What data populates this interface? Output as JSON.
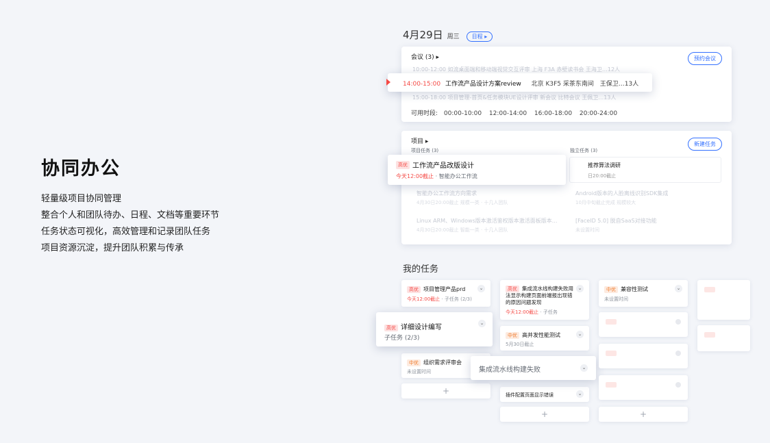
{
  "intro": {
    "title": "协同办公",
    "lines": [
      "轻量级项目协同管理",
      "整合个人和团队待办、日程、文档等重要环节",
      "任务状态可视化，高效管理和记录团队任务",
      "项目资源沉淀，提升团队积累与传承"
    ]
  },
  "header": {
    "date": "4月29日",
    "weekday": "周三",
    "view_toggle": "日程 ▸"
  },
  "meetings": {
    "title": "会议 (3) ▸",
    "book_button": "预约会议",
    "faint_row1": "10:00-12:00  如流桌面端和移动端视觉交互评审     上海 F3A 赤壁读书会   王海卫…12人",
    "faint_row2": "15:00-18:00  项目管理-首页&任务模块UE设计评审     新会议     比特会议    王佩卫…13人",
    "popup": {
      "time": "14:00-15:00",
      "title": "工作流产品设计方案review",
      "room": "北京 K3F5 采茶东南间",
      "attendees": "王保卫…13人"
    },
    "available_label": "可用时段:",
    "slots": [
      "00:00-10:00",
      "12:00-14:00",
      "16:00-18:00",
      "20:00-24:00"
    ]
  },
  "projects": {
    "title": "项目 ▸",
    "new_task_button": "新建任务",
    "project_tasks_label": "项目任务 (3)",
    "solo_tasks_label": "独立任务 (3)",
    "popup": {
      "priority": "高优",
      "title": "工作流产品改版设计",
      "deadline": "今天12:00截止",
      "project": "· 智能办公工作流"
    },
    "solo_card": {
      "title": "推荐算法调研",
      "deadline": "日20:00截止"
    },
    "faint_rows": [
      {
        "left": "智能办公工作流方向需求",
        "left_sub": "4月30日20:00截止    规模一类 · 十几人团队",
        "right": "Android版本的人脸离线识别SDK集成",
        "right_sub": "10月中旬截止完成    规模较大"
      },
      {
        "left": "Linux ARM、Windows版本激活鉴权版本激活面板版本...",
        "left_sub": "4月30日20:00截止    智能一类 · 十几人团队",
        "right": "[FaceID 5.0] 脱自SaaS对接功能",
        "right_sub": "未设置时间"
      }
    ]
  },
  "my_tasks": {
    "title": "我的任务",
    "col1": [
      {
        "priority": "高优",
        "title": "项目管理产品prd",
        "deadline": "今天12:00截止",
        "sub": "· 子任务 (2/3)"
      },
      {
        "priority": "中优",
        "title": "组织需求评审会",
        "sub": "未设置时间"
      }
    ],
    "popup_detail": {
      "priority": "高优",
      "title": "详细设计编写",
      "sub": "子任务 (2/3)"
    },
    "col2": [
      {
        "priority": "高优",
        "title": "集成流水线构建失败用法显示构建页面前端报出现错的原因问题发现",
        "deadline": "今天12:00截止",
        "sub": "· 子任务"
      },
      {
        "priority": "中优",
        "title": "高并发性能测试",
        "sub": "5月30日截止"
      },
      {
        "title": "插件配置页面显示错误"
      }
    ],
    "popup_pipeline": "集成流水线构建失败",
    "col3": [
      {
        "priority": "中优",
        "title": "兼容性测试",
        "sub": "未设置时间"
      }
    ],
    "chevron": "⌄",
    "plus": "+"
  }
}
